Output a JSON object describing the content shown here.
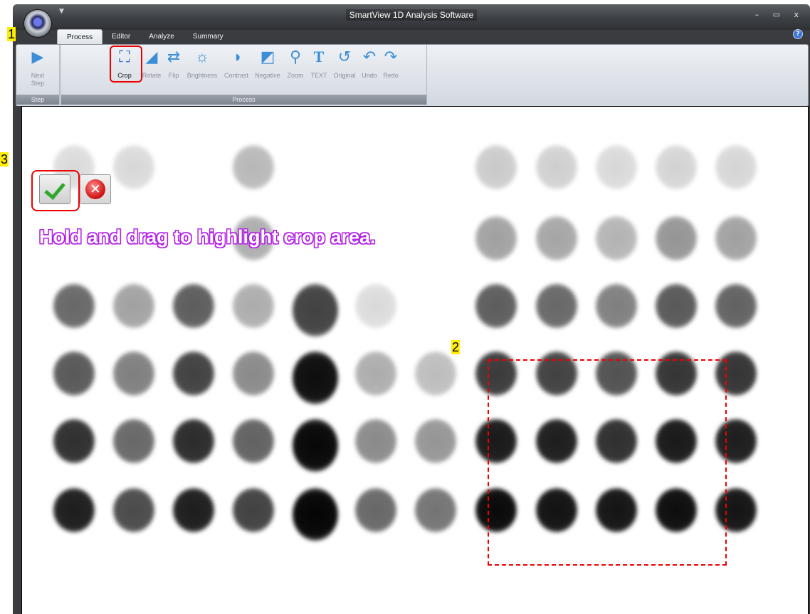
{
  "window": {
    "title": "SmartView 1D Analysis Software",
    "controls": "– ▭ x"
  },
  "tabs": [
    {
      "label": "Process",
      "active": true
    },
    {
      "label": "Editor"
    },
    {
      "label": "Analyze"
    },
    {
      "label": "Summary"
    }
  ],
  "ribbon": {
    "groups": {
      "step": "Step",
      "process": "Process"
    },
    "buttons": [
      {
        "label": "Next\nStep",
        "icon": "play-icon"
      },
      {
        "label": "Crop",
        "icon": "crop-icon",
        "active": true
      },
      {
        "label": "Rotate",
        "icon": "rotate-icon"
      },
      {
        "label": "Flip",
        "icon": "flip-icon"
      },
      {
        "label": "Brightness",
        "icon": "brightness-icon"
      },
      {
        "label": "Contrast",
        "icon": "contrast-icon"
      },
      {
        "label": "Negative",
        "icon": "negative-icon"
      },
      {
        "label": "Zoom",
        "icon": "zoom-icon"
      },
      {
        "label": "TEXT",
        "icon": "text-icon"
      },
      {
        "label": "Original",
        "icon": "original-icon"
      },
      {
        "label": "Undo",
        "icon": "undo-icon"
      },
      {
        "label": "Redo",
        "icon": "redo-icon"
      }
    ]
  },
  "canvas": {
    "hint": "Hold and drag to highlight crop area.",
    "accept_icon": "checkmark-icon",
    "cancel_icon": "cancel-icon",
    "spot_grid": {
      "columns": 12,
      "rows": 6,
      "darkness": [
        [
          0.05,
          0.06,
          0.0,
          0.2,
          0.0,
          0.0,
          0.0,
          0.12,
          0.1,
          0.06,
          0.08,
          0.07
        ],
        [
          0.0,
          0.0,
          0.0,
          0.25,
          0.0,
          0.0,
          0.0,
          0.3,
          0.28,
          0.22,
          0.35,
          0.3
        ],
        [
          0.55,
          0.3,
          0.6,
          0.25,
          0.72,
          0.05,
          0.0,
          0.6,
          0.55,
          0.45,
          0.62,
          0.58
        ],
        [
          0.62,
          0.45,
          0.72,
          0.4,
          0.95,
          0.25,
          0.18,
          0.75,
          0.72,
          0.65,
          0.78,
          0.78
        ],
        [
          0.8,
          0.55,
          0.82,
          0.58,
          0.98,
          0.4,
          0.35,
          0.9,
          0.88,
          0.8,
          0.9,
          0.88
        ],
        [
          0.88,
          0.68,
          0.88,
          0.72,
          0.99,
          0.55,
          0.5,
          0.97,
          0.93,
          0.92,
          0.95,
          0.92
        ]
      ]
    }
  },
  "annotations": [
    "1",
    "2",
    "3"
  ]
}
